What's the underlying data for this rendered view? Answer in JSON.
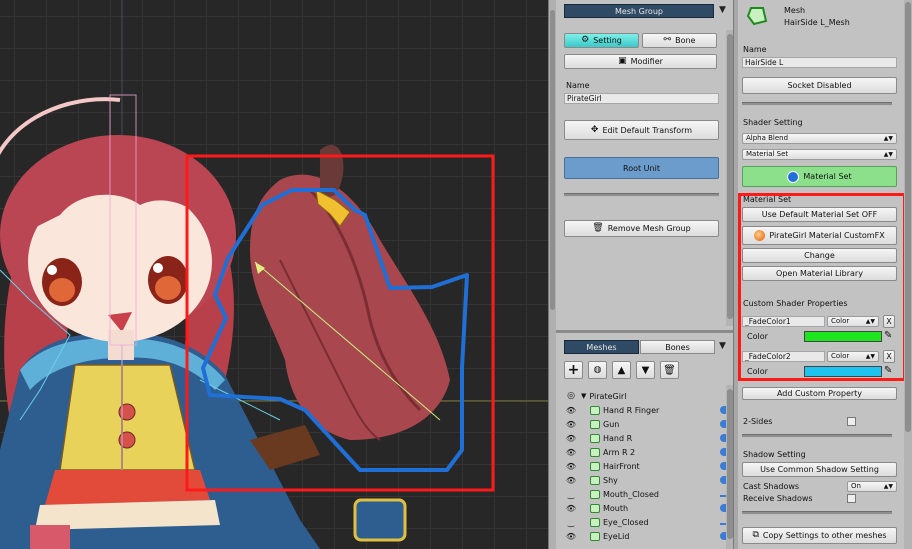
{
  "mesh_group_panel": {
    "header": "Mesh Group",
    "tab_setting": "Setting",
    "tab_bone": "Bone",
    "modifier": "Modifier",
    "name_label": "Name",
    "name_value": "PirateGirl",
    "edit_default_transform": "Edit Default Transform",
    "root_unit": "Root Unit",
    "remove_mesh_group": "Remove Mesh Group"
  },
  "hierarchy": {
    "tab_meshes": "Meshes",
    "tab_bones": "Bones",
    "root": "PirateGirl",
    "items": [
      {
        "label": "Hand R Finger",
        "eye": "open"
      },
      {
        "label": "Gun",
        "eye": "open"
      },
      {
        "label": "Hand R",
        "eye": "open"
      },
      {
        "label": "Arm R 2",
        "eye": "open"
      },
      {
        "label": "HairFront",
        "eye": "open"
      },
      {
        "label": "Shy",
        "eye": "open"
      },
      {
        "label": "Mouth_Closed",
        "eye": "closed"
      },
      {
        "label": "Mouth",
        "eye": "open"
      },
      {
        "label": "Eye_Closed",
        "eye": "closed"
      },
      {
        "label": "EyeLid",
        "eye": "open"
      }
    ]
  },
  "mesh_inspector": {
    "type_label": "Mesh",
    "mesh_name": "HairSide L_Mesh",
    "name_label": "Name",
    "name_value": "HairSide L",
    "socket": "Socket Disabled",
    "shader_setting": "Shader Setting",
    "blend_mode": "Alpha Blend",
    "material_mode": "Material Set",
    "material_set_button": "Material Set",
    "material_set_label": "Material Set",
    "use_default": "Use Default Material Set OFF",
    "material_name": "PirateGirl Material CustomFX",
    "change": "Change",
    "open_library": "Open Material Library",
    "custom_props_label": "Custom Shader Properties",
    "props": [
      {
        "name": "_FadeColor1",
        "type": "Color",
        "color_label": "Color",
        "color": "#1ee61e"
      },
      {
        "name": "_FadeColor2",
        "type": "Color",
        "color_label": "Color",
        "color": "#1fc3f0"
      }
    ],
    "remove_prop": "X",
    "add_custom_property": "Add Custom Property",
    "two_sides": "2-Sides",
    "shadow_setting": "Shadow Setting",
    "use_common_shadow": "Use Common Shadow Setting",
    "cast_shadows": "Cast Shadows",
    "cast_shadows_value": "On",
    "receive_shadows": "Receive Shadows",
    "copy_settings": "Copy Settings to other meshes"
  },
  "colors": {
    "viewport_bg": "#272727",
    "highlight_red": "#ff1a1a",
    "selection_blue": "#1f6fd6",
    "accent_green": "#8ce08c",
    "root_unit_blue": "#6c9ccc",
    "tab_dark": "#2f4a64"
  },
  "icons": [
    "eye-icon",
    "mesh-icon",
    "add-icon",
    "delete-icon",
    "arrow-up-icon",
    "arrow-down-icon",
    "shield-icon",
    "transform-icon",
    "material-icon",
    "eyedropper-icon",
    "copy-icon"
  ]
}
